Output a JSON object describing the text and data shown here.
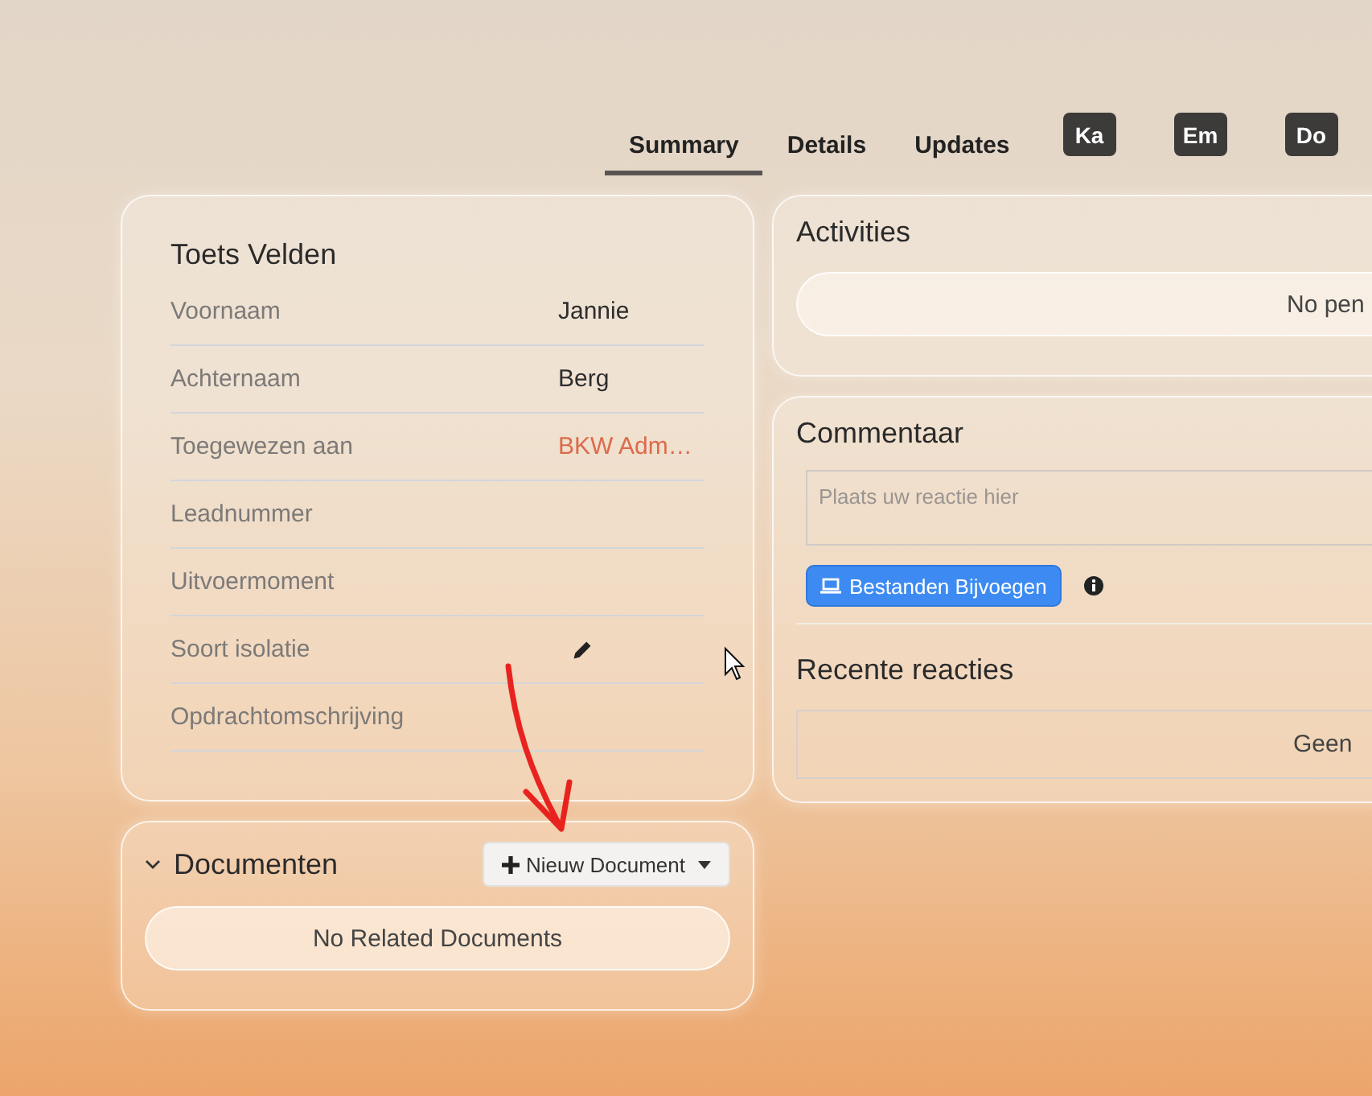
{
  "tabs": [
    {
      "label": "Summary",
      "selected": true
    },
    {
      "label": "Details",
      "selected": false
    },
    {
      "label": "Updates",
      "selected": false
    }
  ],
  "avatars": [
    "Ka",
    "Em",
    "Do"
  ],
  "fields_card": {
    "title": "Toets Velden",
    "fields": [
      {
        "label": "Voornaam",
        "kind": "text",
        "value": "Jannie"
      },
      {
        "label": "Achternaam",
        "kind": "text",
        "value": "Berg"
      },
      {
        "label": "Toegewezen aan",
        "kind": "link",
        "value": "BKW Adm…"
      },
      {
        "label": "Leadnummer",
        "kind": "empty"
      },
      {
        "label": "Uitvoermoment",
        "kind": "empty"
      },
      {
        "label": "Soort isolatie",
        "kind": "edit"
      },
      {
        "label": "Opdrachtomschrijving",
        "kind": "empty"
      }
    ]
  },
  "documents": {
    "title": "Documenten",
    "expanded": true,
    "button": "Nieuw Document",
    "empty_text": "No Related Documents"
  },
  "activities": {
    "title": "Activities",
    "empty_text": "No pen"
  },
  "comments": {
    "title": "Commentaar",
    "placeholder": "Plaats uw reactie hier",
    "attach_button": "Bestanden Bijvoegen",
    "recent_title": "Recente reacties",
    "empty_text": "Geen"
  }
}
